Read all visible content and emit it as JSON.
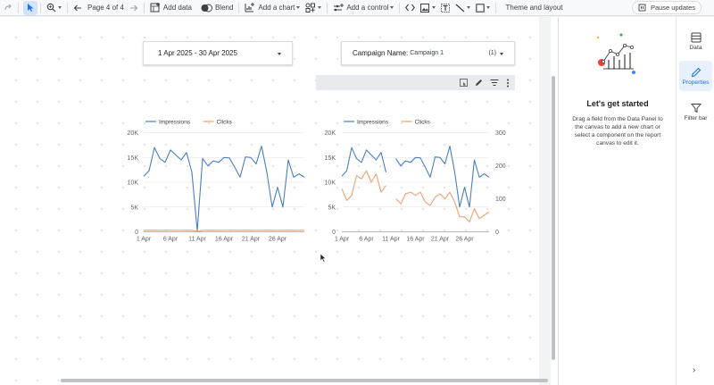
{
  "toolbar": {
    "page_indicator": "Page 4 of 4",
    "add_data": "Add data",
    "blend": "Blend",
    "add_chart": "Add a chart",
    "add_control": "Add a control",
    "theme_layout": "Theme and layout",
    "pause_updates": "Pause updates"
  },
  "controls": {
    "date_range": "1 Apr 2025 - 30 Apr 2025",
    "campaign_label": "Campaign Name:",
    "campaign_value": "Campaign 1",
    "campaign_count": "(1)"
  },
  "panel": {
    "title": "Let's get started",
    "description": "Drag a field from the Data Panel to the canvas to add a new chart or select a component on the report canvas to edit it."
  },
  "rail": {
    "data": "Data",
    "properties": "Properties",
    "filter_bar": "Filter bar"
  },
  "colors": {
    "impressions": "#4a7ec3",
    "clicks": "#f0a070",
    "accent": "#1a73e8"
  },
  "chart_data": [
    {
      "type": "line",
      "legend": [
        "Impressions",
        "Clicks"
      ],
      "x": [
        "1 Apr",
        "2 Apr",
        "3 Apr",
        "4 Apr",
        "5 Apr",
        "6 Apr",
        "7 Apr",
        "8 Apr",
        "9 Apr",
        "10 Apr",
        "11 Apr",
        "12 Apr",
        "13 Apr",
        "14 Apr",
        "15 Apr",
        "16 Apr",
        "17 Apr",
        "18 Apr",
        "19 Apr",
        "20 Apr",
        "21 Apr",
        "22 Apr",
        "23 Apr",
        "24 Apr",
        "25 Apr",
        "26 Apr",
        "27 Apr",
        "28 Apr",
        "29 Apr",
        "30 Apr"
      ],
      "x_tick_labels": [
        "1 Apr",
        "6 Apr",
        "11 Apr",
        "16 Apr",
        "21 Apr",
        "26 Apr"
      ],
      "series": [
        {
          "name": "Impressions",
          "axis": "left",
          "values": [
            11200,
            12300,
            17000,
            14800,
            14000,
            16500,
            15500,
            14500,
            16000,
            12000,
            200,
            14800,
            13300,
            14300,
            14000,
            15000,
            14900,
            13000,
            11000,
            15100,
            15000,
            13700,
            17300,
            12000,
            5000,
            9000,
            5000,
            14500,
            11000,
            11700,
            11000
          ]
        },
        {
          "name": "Clicks",
          "axis": "left",
          "values": [
            300,
            310,
            320,
            300,
            330,
            320,
            300,
            310,
            320,
            300,
            100,
            310,
            300,
            320,
            310,
            300,
            320,
            310,
            300,
            320,
            310,
            300,
            310,
            320,
            300,
            310,
            300,
            320,
            310,
            300,
            310
          ]
        }
      ],
      "left_axis": {
        "ticks": [
          "0",
          "5K",
          "10K",
          "15K",
          "20K"
        ],
        "range": [
          0,
          20000
        ]
      },
      "grid": true,
      "legend_position": "top-left"
    },
    {
      "type": "line",
      "legend": [
        "Impressions",
        "Clicks"
      ],
      "x": [
        "1 Apr",
        "2 Apr",
        "3 Apr",
        "4 Apr",
        "5 Apr",
        "6 Apr",
        "7 Apr",
        "8 Apr",
        "9 Apr",
        "10 Apr",
        "11 Apr",
        "12 Apr",
        "13 Apr",
        "14 Apr",
        "15 Apr",
        "16 Apr",
        "17 Apr",
        "18 Apr",
        "19 Apr",
        "20 Apr",
        "21 Apr",
        "22 Apr",
        "23 Apr",
        "24 Apr",
        "25 Apr",
        "26 Apr",
        "27 Apr",
        "28 Apr",
        "29 Apr",
        "30 Apr"
      ],
      "x_tick_labels": [
        "1 Apr",
        "6 Apr",
        "11 Apr",
        "16 Apr",
        "21 Apr",
        "26 Apr"
      ],
      "series": [
        {
          "name": "Impressions",
          "axis": "left",
          "values": [
            11200,
            12300,
            17000,
            14800,
            14000,
            16500,
            15500,
            14500,
            16000,
            12000,
            null,
            14800,
            13300,
            14300,
            14000,
            15000,
            14900,
            13000,
            11000,
            15100,
            15000,
            13700,
            17300,
            12000,
            5000,
            9000,
            5000,
            14500,
            11000,
            11700,
            11000
          ]
        },
        {
          "name": "Clicks",
          "axis": "right",
          "values": [
            130,
            95,
            110,
            170,
            160,
            185,
            150,
            175,
            120,
            140,
            null,
            100,
            85,
            115,
            120,
            110,
            120,
            90,
            80,
            105,
            115,
            100,
            120,
            90,
            45,
            45,
            30,
            70,
            40,
            50,
            60
          ]
        }
      ],
      "left_axis": {
        "ticks": [
          "0",
          "5K",
          "10K",
          "15K",
          "20K"
        ],
        "range": [
          0,
          20000
        ]
      },
      "right_axis": {
        "ticks": [
          "0",
          "100",
          "200",
          "300"
        ],
        "range": [
          0,
          300
        ]
      },
      "grid": true,
      "legend_position": "top-left"
    }
  ]
}
